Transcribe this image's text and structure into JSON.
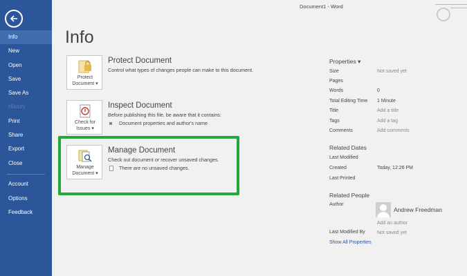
{
  "window": {
    "title": "Document1 - Word"
  },
  "nav": {
    "items": [
      {
        "label": "Info"
      },
      {
        "label": "New"
      },
      {
        "label": "Open"
      },
      {
        "label": "Save"
      },
      {
        "label": "Save As"
      },
      {
        "label": "History"
      },
      {
        "label": "Print"
      },
      {
        "label": "Share"
      },
      {
        "label": "Export"
      },
      {
        "label": "Close"
      },
      {
        "label": "Account"
      },
      {
        "label": "Options"
      },
      {
        "label": "Feedback"
      }
    ]
  },
  "page": {
    "title": "Info"
  },
  "protect": {
    "tile_line1": "Protect",
    "tile_line2": "Document ▾",
    "title": "Protect Document",
    "desc": "Control what types of changes people can make to this document."
  },
  "inspect": {
    "tile_line1": "Check for",
    "tile_line2": "Issues ▾",
    "title": "Inspect Document",
    "desc": "Before publishing this file, be aware that it contains:",
    "bullet": "Document properties and author's name"
  },
  "manage": {
    "tile_line1": "Manage",
    "tile_line2": "Document ▾",
    "title": "Manage Document",
    "desc": "Check out document or recover unsaved changes.",
    "bullet": "There are no unsaved changes."
  },
  "properties": {
    "heading": "Properties ▾",
    "rows": [
      {
        "label": "Size",
        "value": "Not saved yet"
      },
      {
        "label": "Pages",
        "value": ""
      },
      {
        "label": "Words",
        "value": "0"
      },
      {
        "label": "Total Editing Time",
        "value": "1 Minute"
      },
      {
        "label": "Title",
        "value": "Add a title"
      },
      {
        "label": "Tags",
        "value": "Add a tag"
      },
      {
        "label": "Comments",
        "value": "Add comments"
      }
    ]
  },
  "related_dates": {
    "heading": "Related Dates",
    "rows": [
      {
        "label": "Last Modified",
        "value": ""
      },
      {
        "label": "Created",
        "value": "Today, 12:26 PM"
      },
      {
        "label": "Last Printed",
        "value": ""
      }
    ]
  },
  "related_people": {
    "heading": "Related People",
    "author_label": "Author",
    "author_name": "Andrew Freedman",
    "add_author": "Add an author",
    "last_modified_by_label": "Last Modified By",
    "last_modified_by_value": "Not saved yet",
    "show_all": "Show All Properties"
  },
  "colors": {
    "nav_bg": "#2b579a",
    "highlight": "#22a83b",
    "link": "#2b579a"
  }
}
